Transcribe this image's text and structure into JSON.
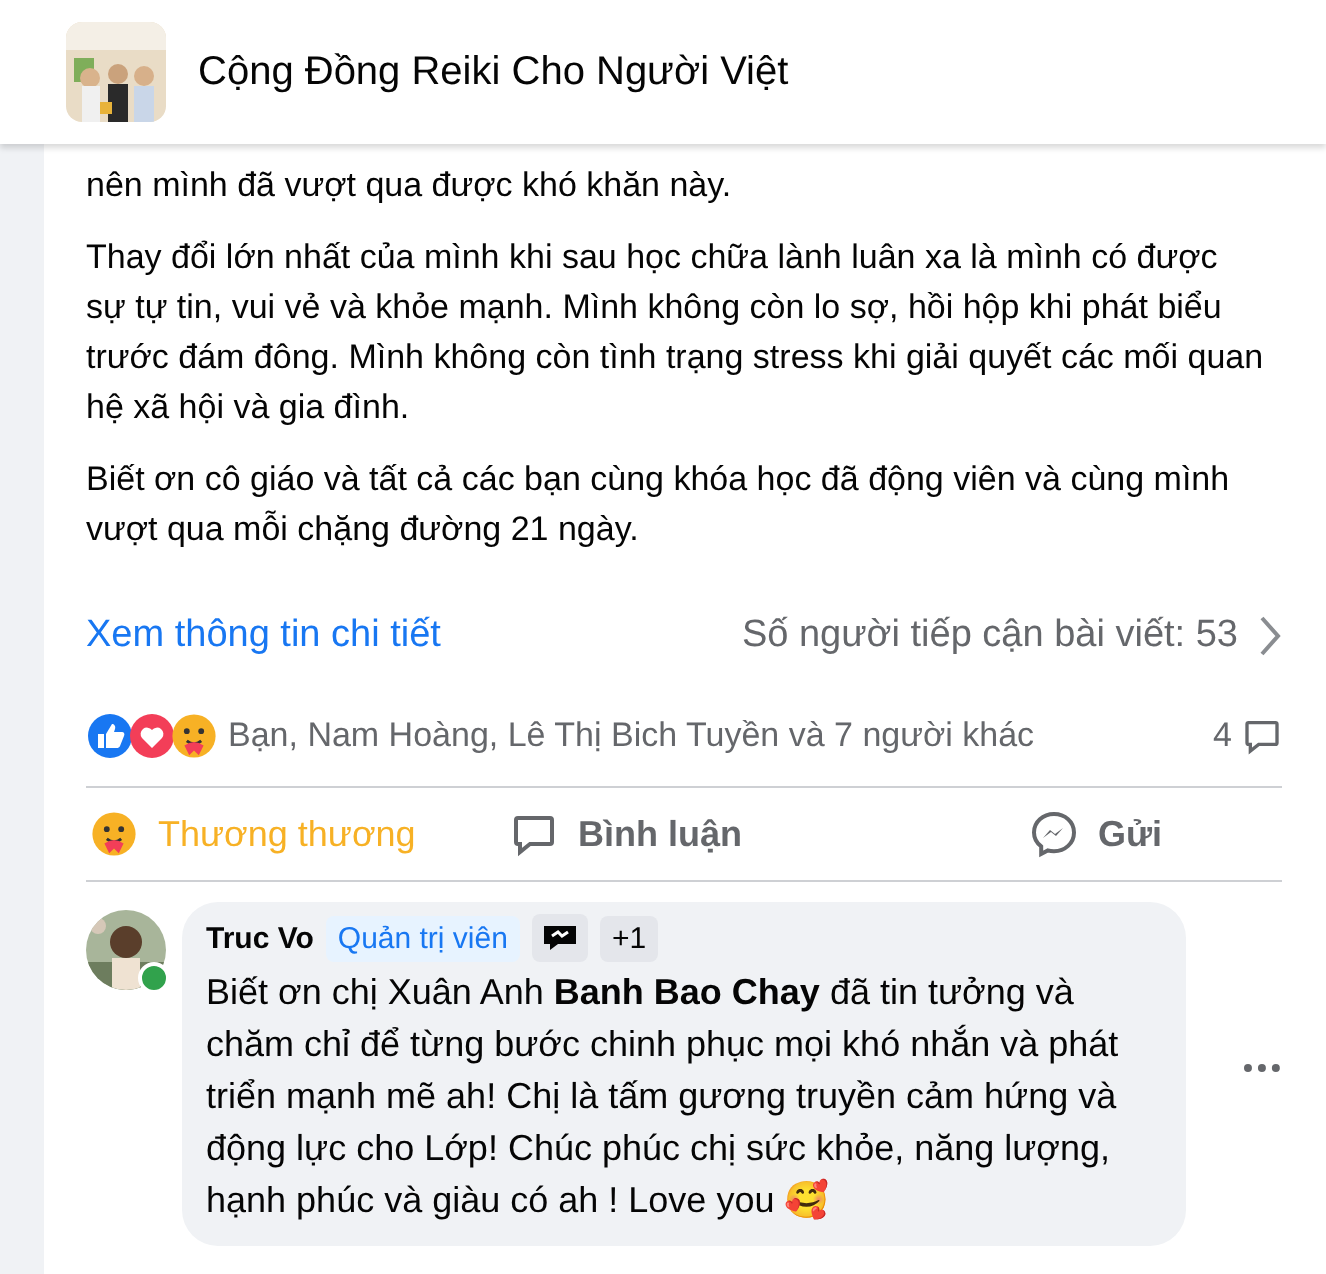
{
  "header": {
    "group_name": "Cộng Đồng Reiki Cho Người Việt"
  },
  "post": {
    "paragraphs": [
      "nên mình đã vượt qua được khó khăn này.",
      "Thay đổi lớn nhất của mình khi sau học chữa lành luân xa là mình có được sự tự tin, vui vẻ và khỏe mạnh. Mình không còn lo sợ, hồi hộp khi phát biểu trước đám đông. Mình không còn tình trạng stress khi giải quyết các mối quan hệ xã hội và gia đình.",
      "Biết ơn cô giáo và tất cả các bạn cùng khóa học đã động viên và cùng mình vượt qua mỗi chặng đường 21 ngày."
    ],
    "details_link": "Xem thông tin chi tiết",
    "reach": "Số người tiếp cận bài viết: 53"
  },
  "reactions": {
    "summary": "Bạn, Nam Hoàng, Lê Thị Bich Tuyền và 7 người khác",
    "comment_count": "4"
  },
  "actions": [
    {
      "kind": "care",
      "label": "Thương thương",
      "selected": true
    },
    {
      "kind": "comment",
      "label": "Bình luận",
      "selected": false
    },
    {
      "kind": "send",
      "label": "Gửi",
      "selected": false
    }
  ],
  "comment": {
    "author": "Truc Vo",
    "online": true,
    "badge": "Quản trị viên",
    "extra_badges": "+1",
    "text": "Biết ơn chị Xuân Anh **Banh Bao Chay** đã tin tưởng và chăm chỉ để từng bước chinh phục mọi khó nhắn và phát triển mạnh mẽ ah! Chị là tấm gương truyền cảm hứng và động lực cho Lớp! Chúc phúc chị sức khỏe, năng lượng, hạnh phúc và giàu có ah ! Love you 🥰"
  }
}
